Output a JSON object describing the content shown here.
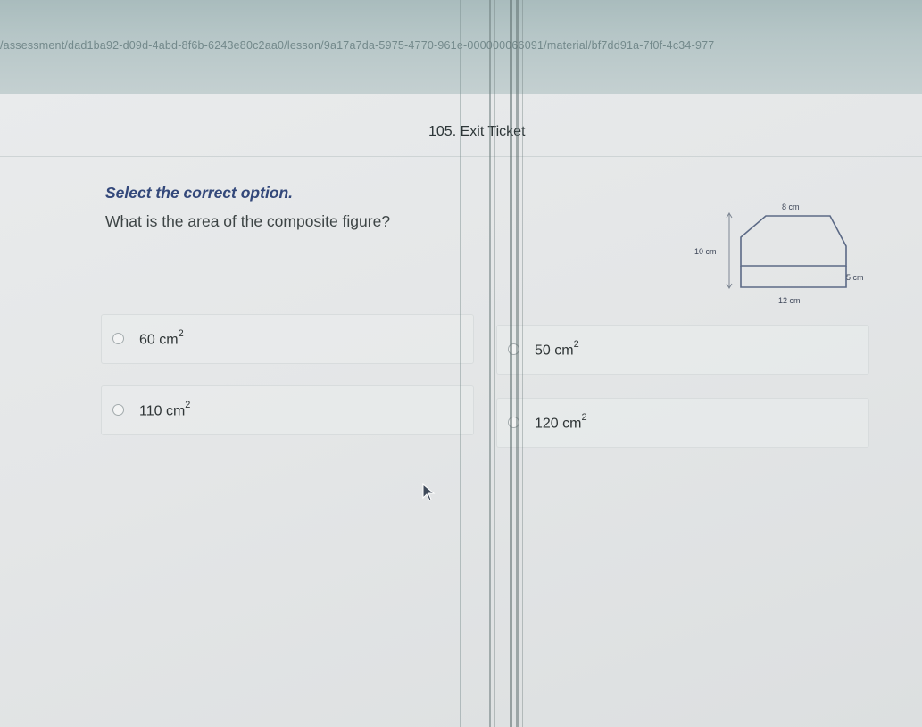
{
  "browser": {
    "url": "/assessment/dad1ba92-d09d-4abd-8f6b-6243e80c2aa0/lesson/9a17a7da-5975-4770-961e-000000066091/material/bf7dd91a-7f0f-4c34-977"
  },
  "header": {
    "title": "105. Exit Ticket"
  },
  "question": {
    "instruction": "Select the correct option.",
    "prompt": "What is the area of the composite figure?"
  },
  "figure": {
    "top_label": "8 cm",
    "left_label": "10 cm",
    "right_label": "5 cm",
    "bottom_label": "12 cm"
  },
  "options": [
    {
      "value": "60 cm",
      "exponent": "2"
    },
    {
      "value": "50 cm",
      "exponent": "2"
    },
    {
      "value": "110 cm",
      "exponent": "2"
    },
    {
      "value": "120 cm",
      "exponent": "2"
    }
  ]
}
